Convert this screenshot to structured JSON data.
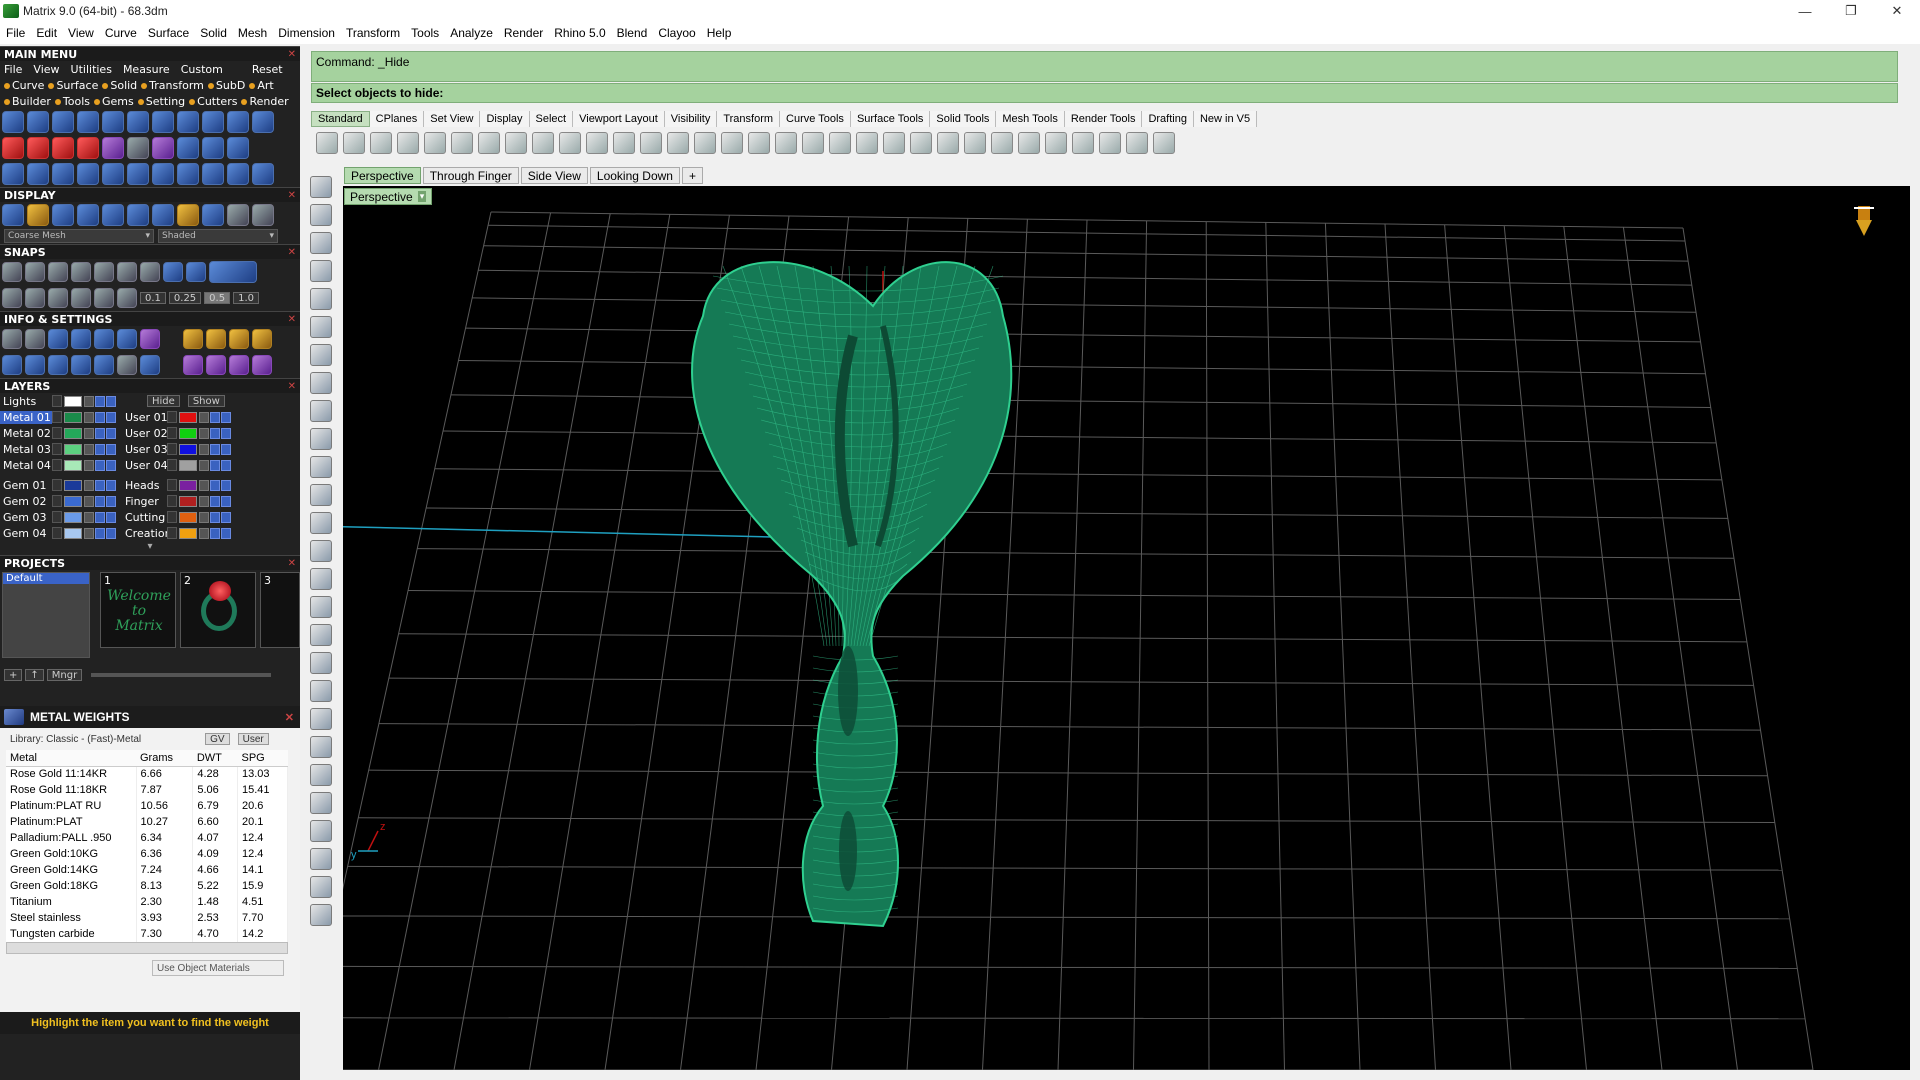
{
  "window": {
    "title": "Matrix 9.0 (64-bit) - 68.3dm",
    "min": "—",
    "max": "❐",
    "close": "✕"
  },
  "menu": [
    "File",
    "Edit",
    "View",
    "Curve",
    "Surface",
    "Solid",
    "Mesh",
    "Dimension",
    "Transform",
    "Tools",
    "Analyze",
    "Render",
    "Rhino 5.0",
    "Blend",
    "Clayoo",
    "Help"
  ],
  "main_menu": {
    "title": "MAIN MENU",
    "sub": [
      "File",
      "View",
      "Utilities",
      "Measure",
      "Custom"
    ],
    "reset": "Reset",
    "row1": [
      "Curve",
      "Surface",
      "Solid",
      "Transform",
      "SubD",
      "Art"
    ],
    "row2": [
      "Builder",
      "Tools",
      "Gems",
      "Setting",
      "Cutters",
      "Render"
    ]
  },
  "display": {
    "title": "DISPLAY",
    "mesh": "Coarse Mesh",
    "mode": "Shaded"
  },
  "snaps": {
    "title": "SNAPS",
    "values": [
      "0.1",
      "0.25",
      "0.5",
      "1.0"
    ]
  },
  "info": {
    "title": "INFO & SETTINGS"
  },
  "layers": {
    "title": "LAYERS",
    "lights": "Lights",
    "hide": "Hide",
    "show": "Show",
    "left": [
      {
        "name": "Metal 01",
        "color": "#1a8a4a",
        "active": true
      },
      {
        "name": "Metal 02",
        "color": "#24a85a"
      },
      {
        "name": "Metal 03",
        "color": "#5cd080"
      },
      {
        "name": "Metal 04",
        "color": "#a8e8b8"
      },
      {
        "name": "Gem 01",
        "color": "#1a3a9a"
      },
      {
        "name": "Gem 02",
        "color": "#3a6ad0"
      },
      {
        "name": "Gem 03",
        "color": "#6a9ae8"
      },
      {
        "name": "Gem 04",
        "color": "#a8c8f0"
      }
    ],
    "right": [
      {
        "name": "User 01",
        "color": "#e01010"
      },
      {
        "name": "User 02",
        "color": "#10d010"
      },
      {
        "name": "User 03",
        "color": "#1010e0"
      },
      {
        "name": "User 04",
        "color": "#a0a0a0"
      },
      {
        "name": "Heads",
        "color": "#7a20a0"
      },
      {
        "name": "Finger",
        "color": "#b02020"
      },
      {
        "name": "Cutting",
        "color": "#e06010"
      },
      {
        "name": "Creation",
        "color": "#f0a010"
      }
    ]
  },
  "projects": {
    "title": "PROJECTS",
    "default": "Default",
    "thumb1": "1",
    "thumb2": "2",
    "thumb3": "3",
    "welcome": "Welcome to Matrix",
    "mngr": "Mngr"
  },
  "metal_weights": {
    "title": "METAL WEIGHTS",
    "library": "Library: Classic - (Fast)-Metal",
    "gv": "GV",
    "user": "User",
    "headers": [
      "Metal",
      "Grams",
      "DWT",
      "SPG"
    ],
    "rows": [
      [
        "Rose Gold 11:14KR",
        "6.66",
        "4.28",
        "13.03"
      ],
      [
        "Rose Gold 11:18KR",
        "7.87",
        "5.06",
        "15.41"
      ],
      [
        "Platinum:PLAT RU",
        "10.56",
        "6.79",
        "20.6"
      ],
      [
        "Platinum:PLAT",
        "10.27",
        "6.60",
        "20.1"
      ],
      [
        "Palladium:PALL .950",
        "6.34",
        "4.07",
        "12.4"
      ],
      [
        "Green Gold:10KG",
        "6.36",
        "4.09",
        "12.4"
      ],
      [
        "Green Gold:14KG",
        "7.24",
        "4.66",
        "14.1"
      ],
      [
        "Green Gold:18KG",
        "8.13",
        "5.22",
        "15.9"
      ],
      [
        "Titanium",
        "2.30",
        "1.48",
        "4.51"
      ],
      [
        "Steel stainless",
        "3.93",
        "2.53",
        "7.70"
      ],
      [
        "Tungsten carbide",
        "7.30",
        "4.70",
        "14.2"
      ]
    ],
    "use_object": "Use Object Materials",
    "footer": "Highlight the item you want to find the weight"
  },
  "command": {
    "line1": "Command: _Hide",
    "line2": "Select objects to hide:"
  },
  "toolbar_tabs": [
    "Standard",
    "CPlanes",
    "Set View",
    "Display",
    "Select",
    "Viewport Layout",
    "Visibility",
    "Transform",
    "Curve Tools",
    "Surface Tools",
    "Solid Tools",
    "Mesh Tools",
    "Render Tools",
    "Drafting",
    "New in V5"
  ],
  "view_tabs": [
    "Perspective",
    "Through Finger",
    "Side View",
    "Looking Down"
  ],
  "viewport": {
    "label": "Perspective",
    "axis_z": "z",
    "axis_y": "y"
  },
  "colors": {
    "mesh": "#1fa070",
    "grid": "#666666",
    "cmd": "#a5d29e"
  }
}
